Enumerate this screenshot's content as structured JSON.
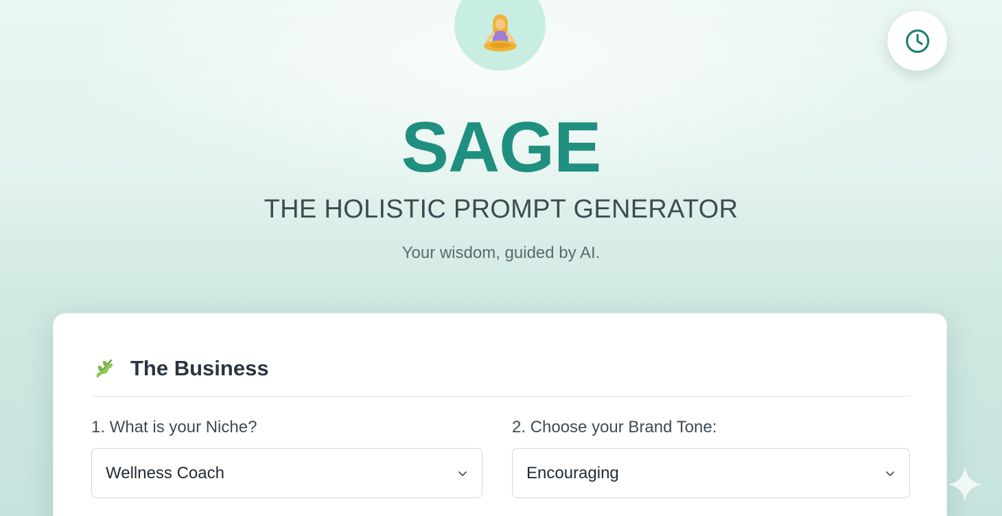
{
  "header": {
    "logo_icon": "person-in-lotus-position-icon",
    "history_icon": "clock-icon"
  },
  "hero": {
    "title": "SAGE",
    "subtitle": "THE HOLISTIC PROMPT GENERATOR",
    "tagline": "Your wisdom, guided by AI."
  },
  "business_section": {
    "icon": "herb-icon",
    "title": "The Business",
    "niche": {
      "label": "1. What is your Niche?",
      "value": "Wellness Coach"
    },
    "tone": {
      "label": "2. Choose your Brand Tone:",
      "value": "Encouraging"
    }
  },
  "colors": {
    "brand": "#1f8f7f",
    "text": "#2b3440",
    "background": "#e2f2ed"
  }
}
